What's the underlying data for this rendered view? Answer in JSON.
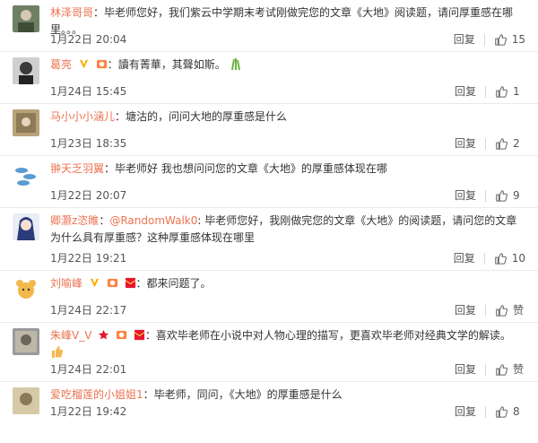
{
  "comments": [
    {
      "name": "林泽哥哥",
      "separator": "：",
      "text": "毕老师您好，我们紫云中学期末考试刚做完您的文章《大地》阅读题，请问厚重感在哪里。。。",
      "time": "1月22日 20:04",
      "reply": "回复",
      "likes": "15"
    },
    {
      "name": "葛亮",
      "separator": "：",
      "text": "讀有菁華，其聲如斯。",
      "time": "1月24日 15:45",
      "reply": "回复",
      "likes": "1"
    },
    {
      "name": "马小小小涵儿",
      "separator": "：",
      "text": "塘沽的，问问大地的厚重感是什么",
      "time": "1月23日 18:35",
      "reply": "回复",
      "likes": "2"
    },
    {
      "name": "翀天乏羽翼",
      "separator": "：",
      "text": "毕老师好 我也想问问您的文章《大地》的厚重感体现在哪",
      "time": "1月22日 20:07",
      "reply": "回复",
      "likes": "9"
    },
    {
      "name": "卿灏z恣睢",
      "separator": "：",
      "mention": "@RandomWalk0",
      "text": ": 毕老师您好，我刚做完您的文章《大地》的阅读题，请问您的文章为什么具有厚重感？这种厚重感体现在哪里",
      "time": "1月22日 19:21",
      "reply": "回复",
      "likes": "10"
    },
    {
      "name": "刘喻峰",
      "separator": "：",
      "text": "都来问题了。",
      "time": "1月24日 22:17",
      "reply": "回复",
      "likes": "赞"
    },
    {
      "name": "朱峰V_V",
      "separator": "：",
      "text": "喜欢毕老师在小说中对人物心理的描写，更喜欢毕老师对经典文学的解读。",
      "time": "1月24日 22:01",
      "reply": "回复",
      "likes": "赞"
    },
    {
      "name": "爱吃榴莲的小姐姐1",
      "separator": "：",
      "text": "毕老师，同问，《大地》的厚重感是什么",
      "time": "1月22日 19:42",
      "reply": "回复",
      "likes": "8"
    }
  ],
  "icons": {
    "like": "thumbs-up-icon",
    "verified": "verified-v-icon",
    "vip": "vip-crown-icon",
    "redpacket": "red-packet-icon",
    "star": "star-icon",
    "emoji_plant": "plant-emoji-icon",
    "emoji_thumb": "thumbs-up-emoji-icon"
  },
  "colors": {
    "name": "#eb7350",
    "mention": "#eb7350",
    "verified": "#ffa800",
    "star": "#e6162d",
    "redpacket": "#e6162d"
  }
}
